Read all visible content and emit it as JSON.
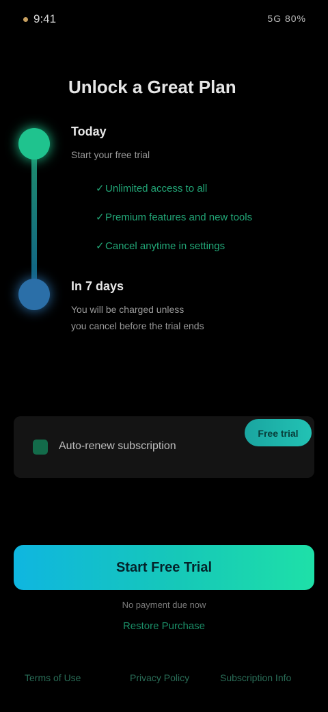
{
  "status": {
    "time": "9:41",
    "right": "5G 80%"
  },
  "header": {
    "title": "Unlock a Great Plan"
  },
  "steps": [
    {
      "title": "Today",
      "subtitle": "Start your free trial",
      "features": [
        "Unlimited access to all",
        "Premium features and new tools",
        "Cancel anytime in settings"
      ]
    },
    {
      "title": "In 7 days",
      "lines": [
        "You will be charged unless",
        "you cancel before the trial ends"
      ]
    }
  ],
  "consent": {
    "label": "Auto-renew subscription",
    "pill": "Free trial"
  },
  "cta": {
    "label": "Start Free Trial"
  },
  "fine_print": "No payment due now",
  "restore": "Restore Purchase",
  "footer": {
    "terms": "Terms of Use",
    "privacy": "Privacy Policy",
    "subscription": "Subscription Info"
  },
  "colors": {
    "accent_green": "#1fc38e",
    "accent_blue": "#2b6fa8",
    "cta_start": "#0fb6e0",
    "cta_end": "#1ee0a8"
  }
}
